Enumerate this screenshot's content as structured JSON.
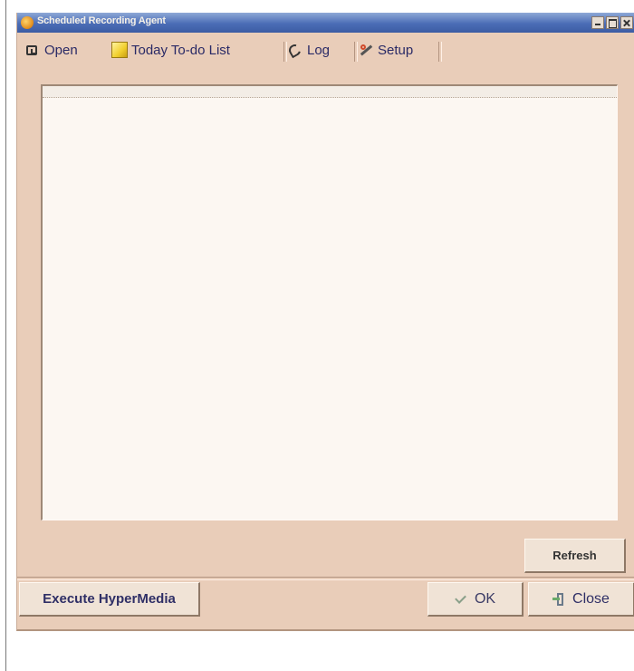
{
  "window": {
    "title": "Scheduled Recording Agent",
    "controls": [
      "minimize-icon",
      "maximize-icon",
      "close-icon"
    ]
  },
  "tabs": [
    {
      "label": "Open",
      "icon": "open-icon"
    },
    {
      "label": "Today To-do List",
      "icon": "note-icon"
    },
    {
      "label": "Log",
      "icon": "log-icon"
    },
    {
      "label": "Setup",
      "icon": "setup-icon"
    }
  ],
  "buttons": {
    "refresh": "Refresh",
    "execute": "Execute HyperMedia",
    "ok": "OK",
    "close": "Close"
  },
  "colors": {
    "window_bg": "#e9cdb9",
    "titlebar": "#4b6db6",
    "panel_bg": "#fcf7f2",
    "text": "#2a2a66"
  }
}
